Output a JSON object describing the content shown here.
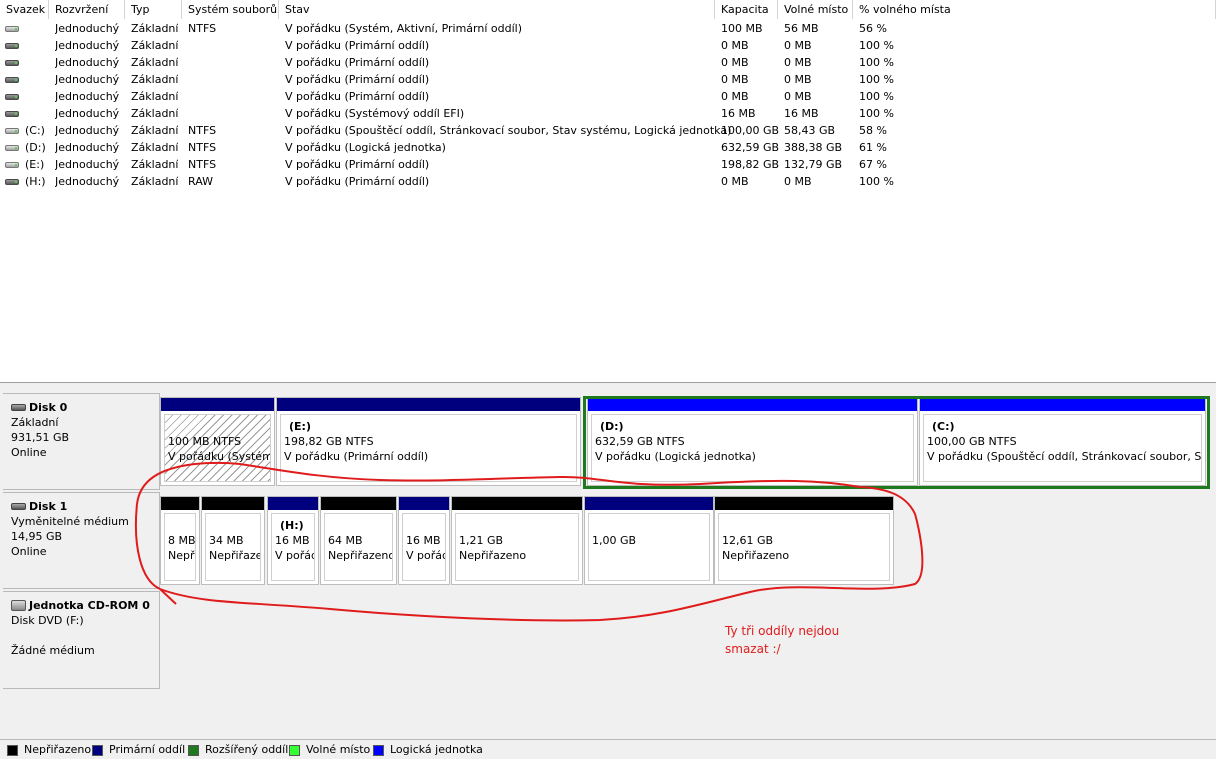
{
  "columns": [
    "Svazek",
    "Rozvržení",
    "Typ",
    "Systém souborů",
    "Stav",
    "Kapacita",
    "Volné místo",
    "% volného místa"
  ],
  "volumes": [
    {
      "volume": "",
      "layout": "Jednoduchý",
      "type": "Základní",
      "fs": "NTFS",
      "status": "V pořádku (Systém, Aktivní, Primární oddíl)",
      "capacity": "100 MB",
      "free": "56 MB",
      "pct": "56 %",
      "icon": "drive-icon-light"
    },
    {
      "volume": "",
      "layout": "Jednoduchý",
      "type": "Základní",
      "fs": "",
      "status": "V pořádku (Primární oddíl)",
      "capacity": "0 MB",
      "free": "0 MB",
      "pct": "100 %",
      "icon": "drive-icon"
    },
    {
      "volume": "",
      "layout": "Jednoduchý",
      "type": "Základní",
      "fs": "",
      "status": "V pořádku (Primární oddíl)",
      "capacity": "0 MB",
      "free": "0 MB",
      "pct": "100 %",
      "icon": "drive-icon"
    },
    {
      "volume": "",
      "layout": "Jednoduchý",
      "type": "Základní",
      "fs": "",
      "status": "V pořádku (Primární oddíl)",
      "capacity": "0 MB",
      "free": "0 MB",
      "pct": "100 %",
      "icon": "drive-icon"
    },
    {
      "volume": "",
      "layout": "Jednoduchý",
      "type": "Základní",
      "fs": "",
      "status": "V pořádku (Primární oddíl)",
      "capacity": "0 MB",
      "free": "0 MB",
      "pct": "100 %",
      "icon": "drive-icon"
    },
    {
      "volume": "",
      "layout": "Jednoduchý",
      "type": "Základní",
      "fs": "",
      "status": "V pořádku (Systémový oddíl EFI)",
      "capacity": "16 MB",
      "free": "16 MB",
      "pct": "100 %",
      "icon": "drive-icon"
    },
    {
      "volume": "(C:)",
      "layout": "Jednoduchý",
      "type": "Základní",
      "fs": "NTFS",
      "status": "V pořádku (Spouštěcí oddíl, Stránkovací soubor, Stav systému, Logická jednotka)",
      "capacity": "100,00 GB",
      "free": "58,43 GB",
      "pct": "58 %",
      "icon": "drive-icon-light"
    },
    {
      "volume": "(D:)",
      "layout": "Jednoduchý",
      "type": "Základní",
      "fs": "NTFS",
      "status": "V pořádku (Logická jednotka)",
      "capacity": "632,59 GB",
      "free": "388,38 GB",
      "pct": "61 %",
      "icon": "drive-icon-light"
    },
    {
      "volume": "(E:)",
      "layout": "Jednoduchý",
      "type": "Základní",
      "fs": "NTFS",
      "status": "V pořádku (Primární oddíl)",
      "capacity": "198,82 GB",
      "free": "132,79 GB",
      "pct": "67 %",
      "icon": "drive-icon-light"
    },
    {
      "volume": "(H:)",
      "layout": "Jednoduchý",
      "type": "Základní",
      "fs": "RAW",
      "status": "V pořádku (Primární oddíl)",
      "capacity": "0 MB",
      "free": "0 MB",
      "pct": "100 %",
      "icon": "drive-icon"
    }
  ],
  "disks": [
    {
      "name": "Disk 0",
      "lines": [
        "Základní",
        "931,51 GB",
        "Online"
      ],
      "icon": "hard-disk-icon",
      "partitions": [
        {
          "name": "",
          "lines": [
            "100 MB NTFS",
            "V pořádku (Systém, Aktivní, Primární oddíl)"
          ],
          "bar": "#00007f",
          "hatched": true
        },
        {
          "name": "(E:)",
          "lines": [
            "198,82 GB NTFS",
            "V pořádku (Primární oddíl)"
          ],
          "bar": "#00007f"
        },
        {
          "name": "(D:)",
          "lines": [
            "632,59 GB NTFS",
            "V pořádku (Logická jednotka)"
          ],
          "bar": "#0000ff"
        },
        {
          "name": "(C:)",
          "lines": [
            "100,00 GB NTFS",
            "V pořádku (Spouštěcí oddíl, Stránkovací soubor, Stav systému, Logická jednotka)"
          ],
          "bar": "#0000ff"
        }
      ]
    },
    {
      "name": "Disk 1",
      "lines": [
        "Vyměnitelné médium",
        "14,95 GB",
        "Online"
      ],
      "icon": "hard-disk-icon",
      "partitions": [
        {
          "name": "",
          "lines": [
            "8 MB",
            "Nepřiřazeno"
          ],
          "bar": "#000000"
        },
        {
          "name": "",
          "lines": [
            "34 MB",
            "Nepřiřazeno"
          ],
          "bar": "#000000"
        },
        {
          "name": "(H:)",
          "lines": [
            "16 MB",
            "V pořádku"
          ],
          "bar": "#00007f"
        },
        {
          "name": "",
          "lines": [
            "64 MB",
            "Nepřiřazeno"
          ],
          "bar": "#000000"
        },
        {
          "name": "",
          "lines": [
            "16 MB",
            "V pořádku"
          ],
          "bar": "#00007f"
        },
        {
          "name": "",
          "lines": [
            "1,21 GB",
            "Nepřiřazeno"
          ],
          "bar": "#000000"
        },
        {
          "name": "",
          "lines": [
            "1,00 GB",
            ""
          ],
          "bar": "#00007f"
        },
        {
          "name": "",
          "lines": [
            "12,61 GB",
            "Nepřiřazeno"
          ],
          "bar": "#000000"
        }
      ]
    },
    {
      "name": "Jednotka CD-ROM 0",
      "lines": [
        "Disk DVD (F:)",
        "",
        "Žádné médium"
      ],
      "icon": "cd-rom-icon",
      "partitions": []
    }
  ],
  "annotation": {
    "line1": "Ty tři oddíly nejdou",
    "line2": "smazat :/",
    "color": "#e01b1b"
  },
  "legend": [
    {
      "label": "Nepřiřazeno",
      "color": "#000000"
    },
    {
      "label": "Primární oddíl",
      "color": "#00007f"
    },
    {
      "label": "Rozšířený oddíl",
      "color": "#1f7a1f"
    },
    {
      "label": "Volné místo",
      "color": "#33ff33"
    },
    {
      "label": "Logická jednotka",
      "color": "#0000ff"
    }
  ]
}
